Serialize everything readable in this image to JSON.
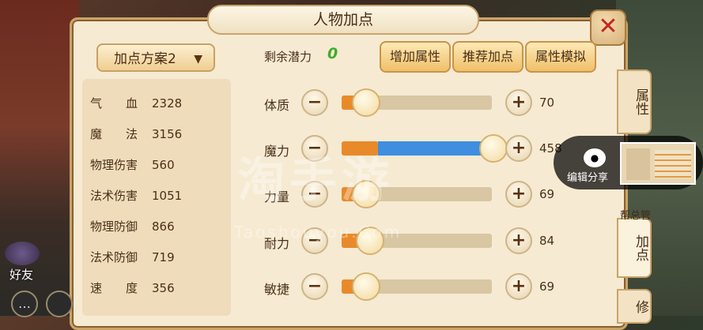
{
  "window": {
    "title": "人物加点"
  },
  "scheme": {
    "label": "加点方案2"
  },
  "stats": [
    {
      "label": "气　　血",
      "value": "2328"
    },
    {
      "label": "魔　　法",
      "value": "3156"
    },
    {
      "label": "物理伤害",
      "value": "560"
    },
    {
      "label": "法术伤害",
      "value": "1051"
    },
    {
      "label": "物理防御",
      "value": "866"
    },
    {
      "label": "法术防御",
      "value": "719"
    },
    {
      "label": "速　　度",
      "value": "356"
    }
  ],
  "potential": {
    "label": "剩余潜力",
    "value": "0"
  },
  "actions": [
    "增加属性",
    "推荐加点",
    "属性模拟"
  ],
  "attributes": [
    {
      "name": "体质",
      "value": "70",
      "level": 0.15
    },
    {
      "name": "魔力",
      "value": "458",
      "level": 1.0
    },
    {
      "name": "力量",
      "value": "69",
      "level": 0.15
    },
    {
      "name": "耐力",
      "value": "84",
      "level": 0.18
    },
    {
      "name": "敏捷",
      "value": "69",
      "level": 0.15
    }
  ],
  "tabs": [
    "属性",
    "加点",
    "修"
  ],
  "share": {
    "label": "编辑分享"
  },
  "watermark": {
    "main": "淘手游",
    "sub": "Taoshouyou.Com"
  },
  "hud": {
    "friend_label": "好友",
    "guild_text": "帮总管"
  },
  "colors": {
    "fill_orange": "#e88a2a",
    "fill_blue": "#3f8ee0",
    "potential_green": "#3fae2a",
    "close_red": "#c7261a"
  }
}
